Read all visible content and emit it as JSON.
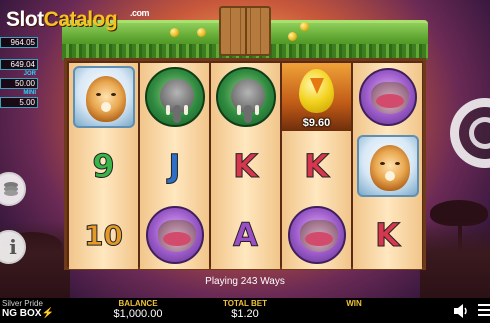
{
  "watermark": {
    "brand_left": "Slot",
    "brand_right": "Catalog",
    "suffix": ".com"
  },
  "side_panel": {
    "values": [
      {
        "tag": "",
        "value": "964.05"
      },
      {
        "tag": "",
        "value": "649.04"
      },
      {
        "tag": "JOR",
        "value": "50.00"
      },
      {
        "tag": "MINI",
        "value": "5.00"
      }
    ],
    "coin_stack_icon": "coin-stack-icon",
    "info_label": "i"
  },
  "reels": {
    "columns": [
      [
        "lion",
        "9",
        "10"
      ],
      [
        "elephant",
        "J",
        "hippo"
      ],
      [
        "elephant",
        "K",
        "A"
      ],
      [
        "egg",
        "K",
        "hippo"
      ],
      [
        "hippo",
        "lion",
        "K"
      ]
    ],
    "egg_prize": "$9.60"
  },
  "status": {
    "ways_text": "Playing 243 Ways"
  },
  "bottom_bar": {
    "game_title": "Silver Pride",
    "brand": "NG BOX",
    "balance_label": "BALANCE",
    "balance_value": "$1,000.00",
    "total_bet_label": "TOTAL BET",
    "total_bet_value": "$1.20",
    "win_label": "WIN",
    "win_value": ""
  },
  "colors": {
    "accent": "#f0c23a",
    "frame_grass": "#5aa12d",
    "side_border": "#3da0b8"
  }
}
